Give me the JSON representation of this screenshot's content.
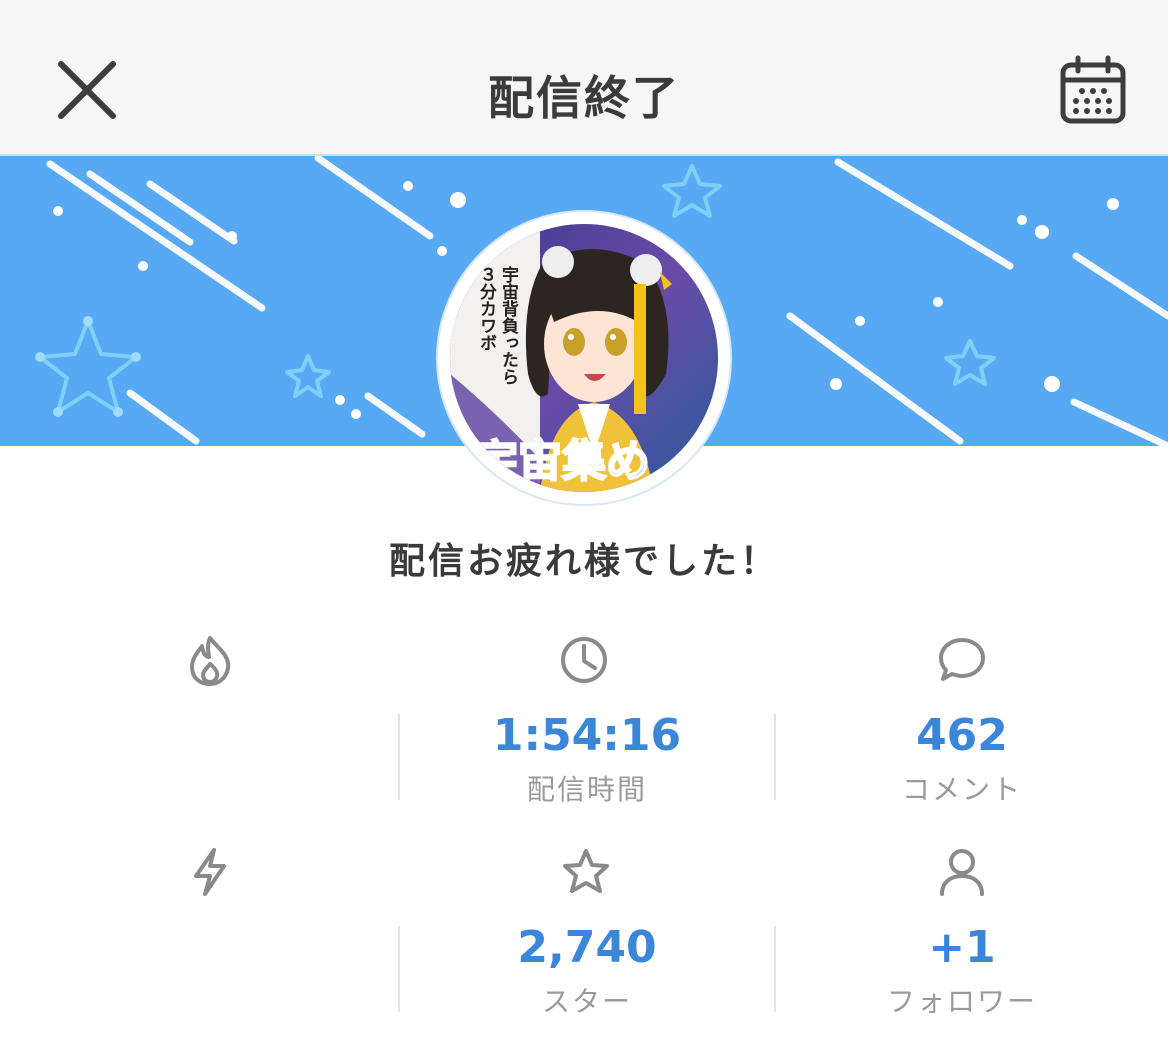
{
  "header": {
    "title": "配信終了",
    "close_icon": "close-icon",
    "calendar_icon": "calendar-icon"
  },
  "banner": {
    "background_color": "#58a9f3",
    "avatar": {
      "text_vertical_1": "宇宙背負ったら",
      "text_vertical_2": "３分カワボ",
      "text_bottom": "宇宙集め"
    }
  },
  "message": "配信お疲れ様でした！",
  "stats": [
    {
      "icon": "flame-icon",
      "value": "",
      "label": ""
    },
    {
      "icon": "clock-icon",
      "value": "1:54:16",
      "label": "配信時間"
    },
    {
      "icon": "comment-icon",
      "value": "462",
      "label": "コメント"
    },
    {
      "icon": "lightning-icon",
      "value": "",
      "label": ""
    },
    {
      "icon": "star-icon",
      "value": "2,740",
      "label": "スター"
    },
    {
      "icon": "person-icon",
      "value": "+1",
      "label": "フォロワー"
    }
  ],
  "colors": {
    "accent": "#3c86d9",
    "label": "#9a9a9a",
    "icon": "#8a8a8a"
  }
}
